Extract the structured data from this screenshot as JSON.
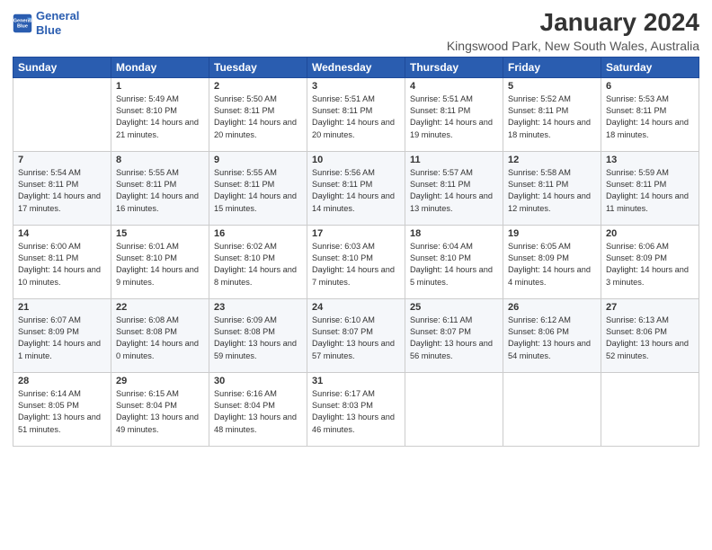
{
  "logo": {
    "line1": "General",
    "line2": "Blue"
  },
  "title": "January 2024",
  "subtitle": "Kingswood Park, New South Wales, Australia",
  "days_header": [
    "Sunday",
    "Monday",
    "Tuesday",
    "Wednesday",
    "Thursday",
    "Friday",
    "Saturday"
  ],
  "weeks": [
    [
      {
        "day": "",
        "info": ""
      },
      {
        "day": "1",
        "info": "Sunrise: 5:49 AM\nSunset: 8:10 PM\nDaylight: 14 hours\nand 21 minutes."
      },
      {
        "day": "2",
        "info": "Sunrise: 5:50 AM\nSunset: 8:11 PM\nDaylight: 14 hours\nand 20 minutes."
      },
      {
        "day": "3",
        "info": "Sunrise: 5:51 AM\nSunset: 8:11 PM\nDaylight: 14 hours\nand 20 minutes."
      },
      {
        "day": "4",
        "info": "Sunrise: 5:51 AM\nSunset: 8:11 PM\nDaylight: 14 hours\nand 19 minutes."
      },
      {
        "day": "5",
        "info": "Sunrise: 5:52 AM\nSunset: 8:11 PM\nDaylight: 14 hours\nand 18 minutes."
      },
      {
        "day": "6",
        "info": "Sunrise: 5:53 AM\nSunset: 8:11 PM\nDaylight: 14 hours\nand 18 minutes."
      }
    ],
    [
      {
        "day": "7",
        "info": "Sunrise: 5:54 AM\nSunset: 8:11 PM\nDaylight: 14 hours\nand 17 minutes."
      },
      {
        "day": "8",
        "info": "Sunrise: 5:55 AM\nSunset: 8:11 PM\nDaylight: 14 hours\nand 16 minutes."
      },
      {
        "day": "9",
        "info": "Sunrise: 5:55 AM\nSunset: 8:11 PM\nDaylight: 14 hours\nand 15 minutes."
      },
      {
        "day": "10",
        "info": "Sunrise: 5:56 AM\nSunset: 8:11 PM\nDaylight: 14 hours\nand 14 minutes."
      },
      {
        "day": "11",
        "info": "Sunrise: 5:57 AM\nSunset: 8:11 PM\nDaylight: 14 hours\nand 13 minutes."
      },
      {
        "day": "12",
        "info": "Sunrise: 5:58 AM\nSunset: 8:11 PM\nDaylight: 14 hours\nand 12 minutes."
      },
      {
        "day": "13",
        "info": "Sunrise: 5:59 AM\nSunset: 8:11 PM\nDaylight: 14 hours\nand 11 minutes."
      }
    ],
    [
      {
        "day": "14",
        "info": "Sunrise: 6:00 AM\nSunset: 8:11 PM\nDaylight: 14 hours\nand 10 minutes."
      },
      {
        "day": "15",
        "info": "Sunrise: 6:01 AM\nSunset: 8:10 PM\nDaylight: 14 hours\nand 9 minutes."
      },
      {
        "day": "16",
        "info": "Sunrise: 6:02 AM\nSunset: 8:10 PM\nDaylight: 14 hours\nand 8 minutes."
      },
      {
        "day": "17",
        "info": "Sunrise: 6:03 AM\nSunset: 8:10 PM\nDaylight: 14 hours\nand 7 minutes."
      },
      {
        "day": "18",
        "info": "Sunrise: 6:04 AM\nSunset: 8:10 PM\nDaylight: 14 hours\nand 5 minutes."
      },
      {
        "day": "19",
        "info": "Sunrise: 6:05 AM\nSunset: 8:09 PM\nDaylight: 14 hours\nand 4 minutes."
      },
      {
        "day": "20",
        "info": "Sunrise: 6:06 AM\nSunset: 8:09 PM\nDaylight: 14 hours\nand 3 minutes."
      }
    ],
    [
      {
        "day": "21",
        "info": "Sunrise: 6:07 AM\nSunset: 8:09 PM\nDaylight: 14 hours\nand 1 minute."
      },
      {
        "day": "22",
        "info": "Sunrise: 6:08 AM\nSunset: 8:08 PM\nDaylight: 14 hours\nand 0 minutes."
      },
      {
        "day": "23",
        "info": "Sunrise: 6:09 AM\nSunset: 8:08 PM\nDaylight: 13 hours\nand 59 minutes."
      },
      {
        "day": "24",
        "info": "Sunrise: 6:10 AM\nSunset: 8:07 PM\nDaylight: 13 hours\nand 57 minutes."
      },
      {
        "day": "25",
        "info": "Sunrise: 6:11 AM\nSunset: 8:07 PM\nDaylight: 13 hours\nand 56 minutes."
      },
      {
        "day": "26",
        "info": "Sunrise: 6:12 AM\nSunset: 8:06 PM\nDaylight: 13 hours\nand 54 minutes."
      },
      {
        "day": "27",
        "info": "Sunrise: 6:13 AM\nSunset: 8:06 PM\nDaylight: 13 hours\nand 52 minutes."
      }
    ],
    [
      {
        "day": "28",
        "info": "Sunrise: 6:14 AM\nSunset: 8:05 PM\nDaylight: 13 hours\nand 51 minutes."
      },
      {
        "day": "29",
        "info": "Sunrise: 6:15 AM\nSunset: 8:04 PM\nDaylight: 13 hours\nand 49 minutes."
      },
      {
        "day": "30",
        "info": "Sunrise: 6:16 AM\nSunset: 8:04 PM\nDaylight: 13 hours\nand 48 minutes."
      },
      {
        "day": "31",
        "info": "Sunrise: 6:17 AM\nSunset: 8:03 PM\nDaylight: 13 hours\nand 46 minutes."
      },
      {
        "day": "",
        "info": ""
      },
      {
        "day": "",
        "info": ""
      },
      {
        "day": "",
        "info": ""
      }
    ]
  ]
}
